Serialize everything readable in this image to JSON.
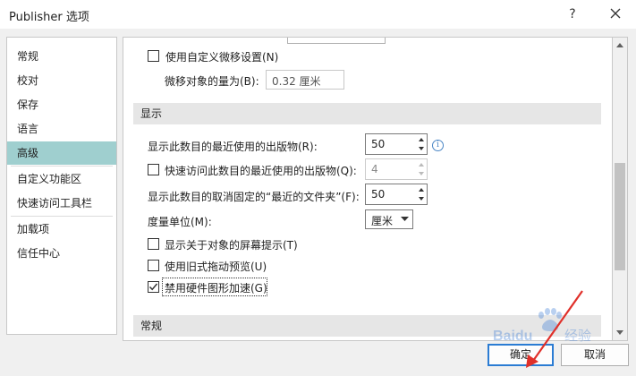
{
  "window": {
    "title": "Publisher 选项",
    "help_glyph": "?",
    "close_icon": "close-icon"
  },
  "sidebar": {
    "items": [
      {
        "label": "常规"
      },
      {
        "label": "校对"
      },
      {
        "label": "保存"
      },
      {
        "label": "语言"
      },
      {
        "label": "高级"
      },
      {
        "label": "自定义功能区"
      },
      {
        "label": "快速访问工具栏"
      },
      {
        "label": "加载项"
      },
      {
        "label": "信任中心"
      }
    ],
    "selected_label": "高级",
    "selected_color": "#9fcfcf"
  },
  "content": {
    "custom_nudge": {
      "label": "使用自定义微移设置(N)",
      "checked": false
    },
    "nudge_amount": {
      "label": "微移对象的量为(B):",
      "value": "0.32 厘米"
    },
    "display_section": {
      "title": "显示"
    },
    "recent_pubs": {
      "label": "显示此数目的最近使用的出版物(R):",
      "value": "50"
    },
    "quick_access_recent": {
      "label": "快速访问此数目的最近使用的出版物(Q):",
      "value": "4",
      "checked": false
    },
    "recent_folders": {
      "label": "显示此数目的取消固定的“最近的文件夹”(F):",
      "value": "50"
    },
    "measure_units": {
      "label": "度量单位(M):",
      "value": "厘米"
    },
    "screen_tips": {
      "label": "显示关于对象的屏幕提示(T)",
      "checked": false
    },
    "legacy_drag": {
      "label": "使用旧式拖动预览(U)",
      "checked": false
    },
    "disable_hw_accel": {
      "label": "禁用硬件图形加速(G)",
      "checked": true
    },
    "general_section": {
      "title": "常规"
    }
  },
  "buttons": {
    "ok": "确定",
    "cancel": "取消"
  },
  "watermark": {
    "brand": "Baidu 经验",
    "brand_color": "#3a7bd5"
  },
  "accent_color": "#2b7cd3",
  "pointer_color": "#e0302a"
}
